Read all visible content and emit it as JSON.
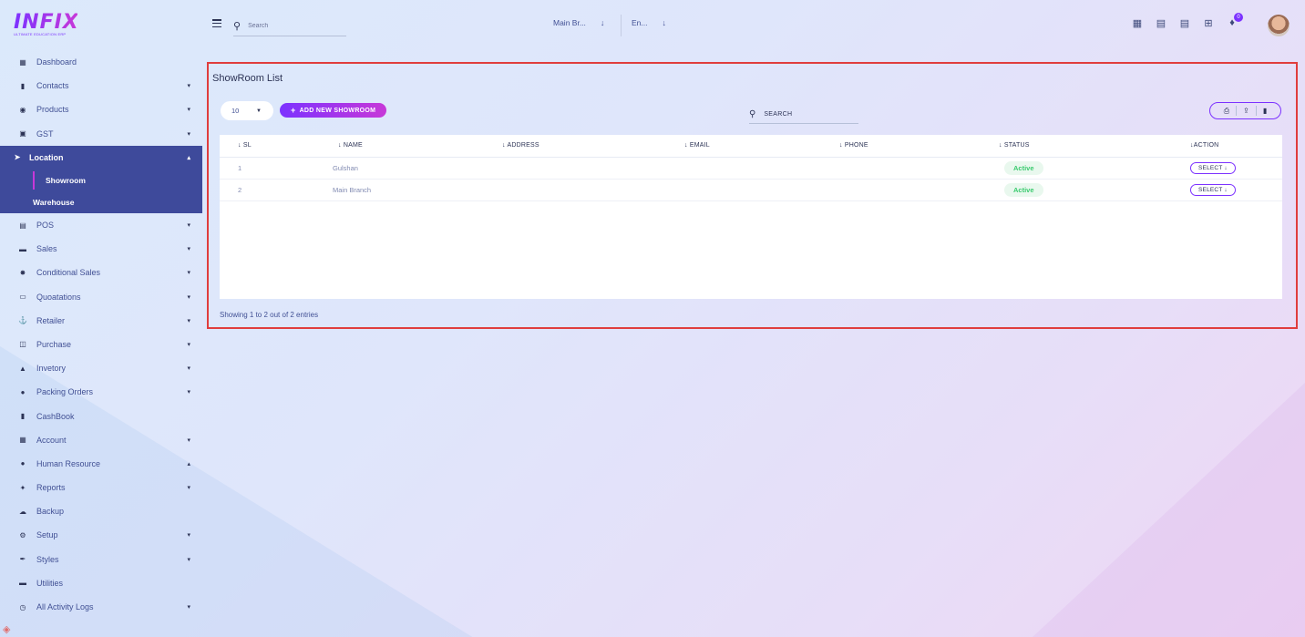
{
  "brand": {
    "logo_text": "INFIX",
    "logo_subtext": "ULTIMATE EDUCATION ERP"
  },
  "header": {
    "search_placeholder": "Search",
    "branch": "Main Br...",
    "language": "En...",
    "notifications_count": "0"
  },
  "sidebar": {
    "items": [
      {
        "label": "Dashboard",
        "icon": "grid-icon",
        "has_caret": false
      },
      {
        "label": "Contacts",
        "icon": "contacts-icon",
        "has_caret": true
      },
      {
        "label": "Products",
        "icon": "products-icon",
        "has_caret": true
      },
      {
        "label": "GST",
        "icon": "gst-icon",
        "has_caret": true
      },
      {
        "label": "Location",
        "icon": "location-arrow-icon",
        "has_caret": true,
        "active": true
      },
      {
        "label": "POS",
        "icon": "pos-icon",
        "has_caret": true
      },
      {
        "label": "Sales",
        "icon": "sales-icon",
        "has_caret": true
      },
      {
        "label": "Conditional Sales",
        "icon": "hammer-icon",
        "has_caret": true
      },
      {
        "label": "Quoatations",
        "icon": "quotations-icon",
        "has_caret": true
      },
      {
        "label": "Retailer",
        "icon": "retailer-icon",
        "has_caret": true
      },
      {
        "label": "Purchase",
        "icon": "purchase-icon",
        "has_caret": true
      },
      {
        "label": "Invetory",
        "icon": "inventory-icon",
        "has_caret": true
      },
      {
        "label": "Packing Orders",
        "icon": "users-icon",
        "has_caret": true
      },
      {
        "label": "CashBook",
        "icon": "book-icon",
        "has_caret": false
      },
      {
        "label": "Account",
        "icon": "calculator-icon",
        "has_caret": true
      },
      {
        "label": "Human Resource",
        "icon": "people-icon",
        "has_caret": true
      },
      {
        "label": "Reports",
        "icon": "reports-icon",
        "has_caret": true
      },
      {
        "label": "Backup",
        "icon": "cloud-icon",
        "has_caret": false
      },
      {
        "label": "Setup",
        "icon": "gear-icon",
        "has_caret": true
      },
      {
        "label": "Styles",
        "icon": "brush-icon",
        "has_caret": true
      },
      {
        "label": "Utilities",
        "icon": "utilities-icon",
        "has_caret": false
      },
      {
        "label": "All Activity Logs",
        "icon": "clock-icon",
        "has_caret": true
      }
    ],
    "location_submenu": [
      "Showroom",
      "Warehouse"
    ]
  },
  "main": {
    "title": "ShowRoom List",
    "per_page": "10",
    "add_button": "ADD NEW SHOWROOM",
    "search_placeholder": "SEARCH",
    "columns": [
      "SL",
      "NAME",
      "ADDRESS",
      "EMAIL",
      "PHONE",
      "STATUS",
      "ACTION"
    ],
    "rows": [
      {
        "sl": "1",
        "name": "Gulshan",
        "address": "",
        "email": "",
        "phone": "",
        "status": "Active",
        "action": "SELECT"
      },
      {
        "sl": "2",
        "name": "Main Branch",
        "address": "",
        "email": "",
        "phone": "",
        "status": "Active",
        "action": "SELECT"
      }
    ],
    "footer": "Showing 1 to 2 out of 2 entries"
  },
  "colors": {
    "accent": "#7c32ff",
    "accent2": "#c738d8",
    "sidebar_active": "#3e4a9b",
    "highlight_border": "#e03d3d",
    "status_green": "#3bcb6f"
  }
}
